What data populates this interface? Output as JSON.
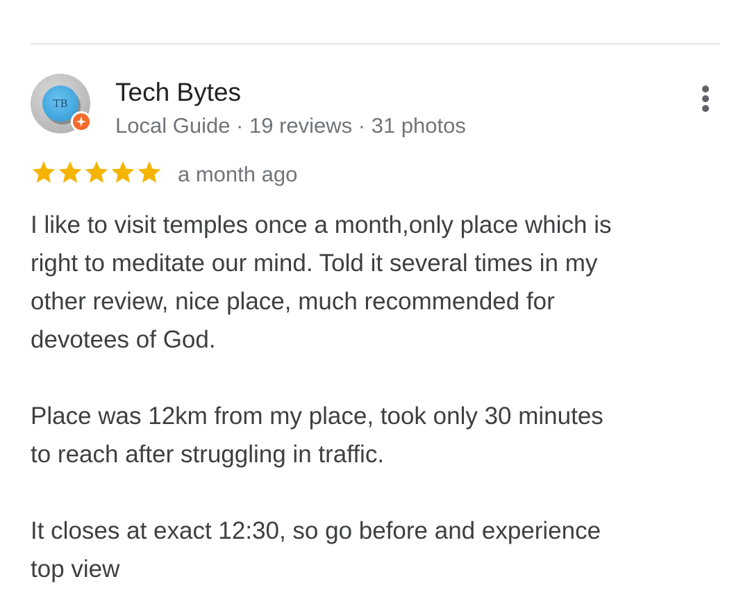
{
  "review": {
    "author": {
      "name": "Tech Bytes",
      "avatar_initials": "TB",
      "meta": "Local Guide · 19 reviews · 31 photos",
      "badge_icon": "local-guide-badge-icon"
    },
    "rating": 5,
    "rating_max": 5,
    "time_ago": "a month ago",
    "paragraphs": [
      "I like to visit temples once a month,only place which is\nright to meditate our mind. Told it several times in my\nother review, nice place, much recommended for\ndevotees of God.",
      "Place was 12km from my place, took only 30 minutes\nto reach after struggling in traffic.",
      "It closes at exact 12:30, so go before and experience\ntop view"
    ]
  },
  "icons": {
    "more": "more-vert-icon",
    "star": "star-icon"
  },
  "colors": {
    "star": "#F4B400",
    "badge": "#F26B2A",
    "meta_text": "#70757A",
    "body_text": "#3C4043",
    "divider": "#E3E3E3"
  }
}
